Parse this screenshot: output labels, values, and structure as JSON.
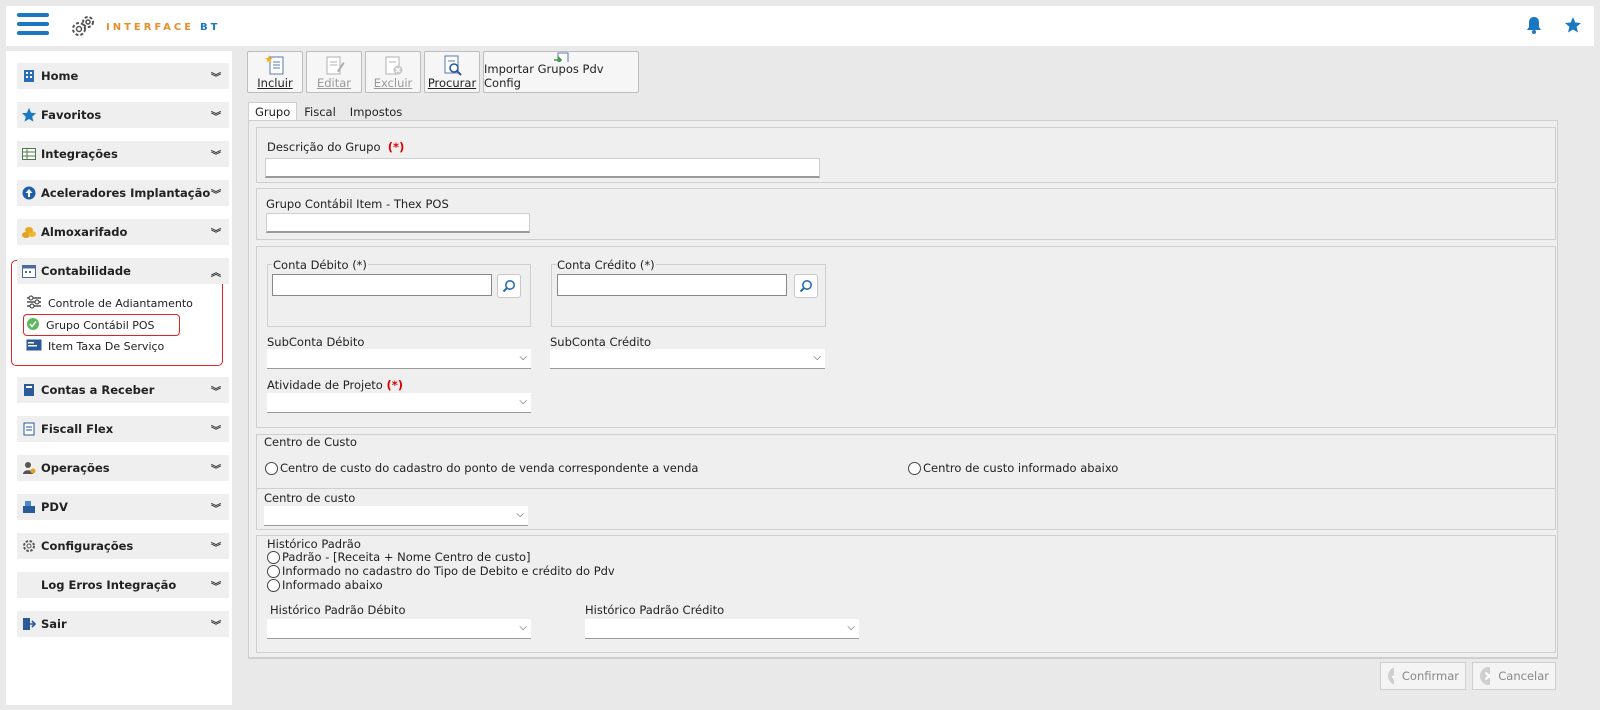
{
  "header": {
    "logo_text": "INTERFACE",
    "logo_suffix": "BT"
  },
  "sidebar": {
    "items": [
      {
        "label": "Home",
        "icon": "building-icon"
      },
      {
        "label": "Favoritos",
        "icon": "star-icon"
      },
      {
        "label": "Integrações",
        "icon": "table-icon"
      },
      {
        "label": "Aceleradores Implantação",
        "icon": "arrow-up-circle-icon"
      },
      {
        "label": "Almoxarifado",
        "icon": "coins-icon"
      },
      {
        "label": "Contabilidade",
        "icon": "calendar-icon"
      },
      {
        "label": "Contas a Receber",
        "icon": "book-icon"
      },
      {
        "label": "Fiscall Flex",
        "icon": "document-icon"
      },
      {
        "label": "Operações",
        "icon": "user-gear-icon"
      },
      {
        "label": "PDV",
        "icon": "cash-register-icon"
      },
      {
        "label": "Configurações",
        "icon": "gear-icon"
      },
      {
        "label": "Log Erros Integração",
        "icon": "log-icon"
      },
      {
        "label": "Sair",
        "icon": "exit-icon"
      }
    ],
    "contabilidade_sub": [
      {
        "label": "Controle de Adiantamento",
        "icon": "sliders-icon"
      },
      {
        "label": "Grupo Contábil POS",
        "icon": "check-circle-icon"
      },
      {
        "label": "Item Taxa De Serviço",
        "icon": "receipt-icon"
      }
    ]
  },
  "toolbar": {
    "incluir": "Incluir",
    "editar": "Editar",
    "excluir": "Excluir",
    "procurar": "Procurar",
    "importar": "Importar Grupos Pdv Config"
  },
  "tabs": [
    "Grupo",
    "Fiscal",
    "Impostos"
  ],
  "form": {
    "descricao_label": "Descrição do Grupo",
    "required_mark": "(*)",
    "grupo_contabil_label": "Grupo Contábil Item - Thex POS",
    "conta_debito_label": "Conta Débito (*)",
    "conta_credito_label": "Conta Crédito (*)",
    "subconta_debito_label": "SubConta Débito",
    "subconta_credito_label": "SubConta Crédito",
    "atividade_label": "Atividade de Projeto",
    "centro_custo_title": "Centro de Custo",
    "cc_option1": "Centro de custo do cadastro do ponto de venda correspondente a venda",
    "cc_option2": "Centro de custo informado abaixo",
    "centro_custo_label": "Centro de custo",
    "historico_title": "Histórico Padrão",
    "hist_option1": "Padrão - [Receita + Nome Centro de custo]",
    "hist_option2": "Informado no cadastro do Tipo de Debito e crédito do Pdv",
    "hist_option3": "Informado abaixo",
    "hist_debito_label": "Histórico Padrão Débito",
    "hist_credito_label": "Histórico Padrão Crédito"
  },
  "footer": {
    "confirmar": "Confirmar",
    "cancelar": "Cancelar"
  },
  "colors": {
    "accent": "#1a78c2",
    "logo_orange": "#e88f2c",
    "highlight_red": "#e02424"
  }
}
